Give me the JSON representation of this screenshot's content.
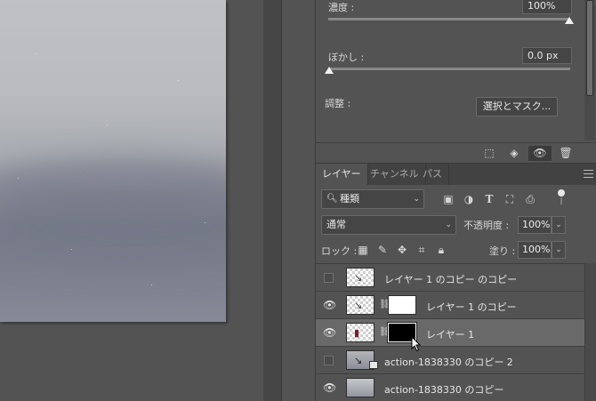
{
  "properties": {
    "density_label": "濃度 :",
    "density_value": "100%",
    "feather_label": "ぼかし :",
    "feather_value": "0.0 px",
    "adjust_label": "調整 :",
    "select_mask_button": "選択とマスク...",
    "icons": [
      "selection-icon",
      "apply-mask-icon",
      "visibility-icon",
      "trash-icon"
    ]
  },
  "layers_panel": {
    "tabs": [
      {
        "label": "レイヤー",
        "active": true
      },
      {
        "label": "チャンネル",
        "active": false
      },
      {
        "label": "パス",
        "active": false
      }
    ],
    "filter_kind": "種類",
    "blend_mode": "通常",
    "opacity_label": "不透明度 :",
    "opacity_value": "100%",
    "lock_label": "ロック :",
    "fill_label": "塗り :",
    "fill_value": "100%",
    "layers": [
      {
        "name": "レイヤー 1 のコピー のコピー",
        "visible": false,
        "selected": false,
        "has_mask": false
      },
      {
        "name": "レイヤー 1 のコピー",
        "visible": true,
        "selected": false,
        "has_mask": true,
        "mask": "white"
      },
      {
        "name": "レイヤー 1",
        "visible": true,
        "selected": true,
        "has_mask": true,
        "mask": "black"
      },
      {
        "name": "action-1838330 のコピー 2",
        "visible": false,
        "selected": false,
        "has_mask": false
      },
      {
        "name": "action-1838330 のコピー",
        "visible": true,
        "selected": false,
        "has_mask": false
      }
    ]
  },
  "colors": {
    "panel_bg": "#535353",
    "selected_row": "#696969",
    "field_bg": "#454545"
  }
}
